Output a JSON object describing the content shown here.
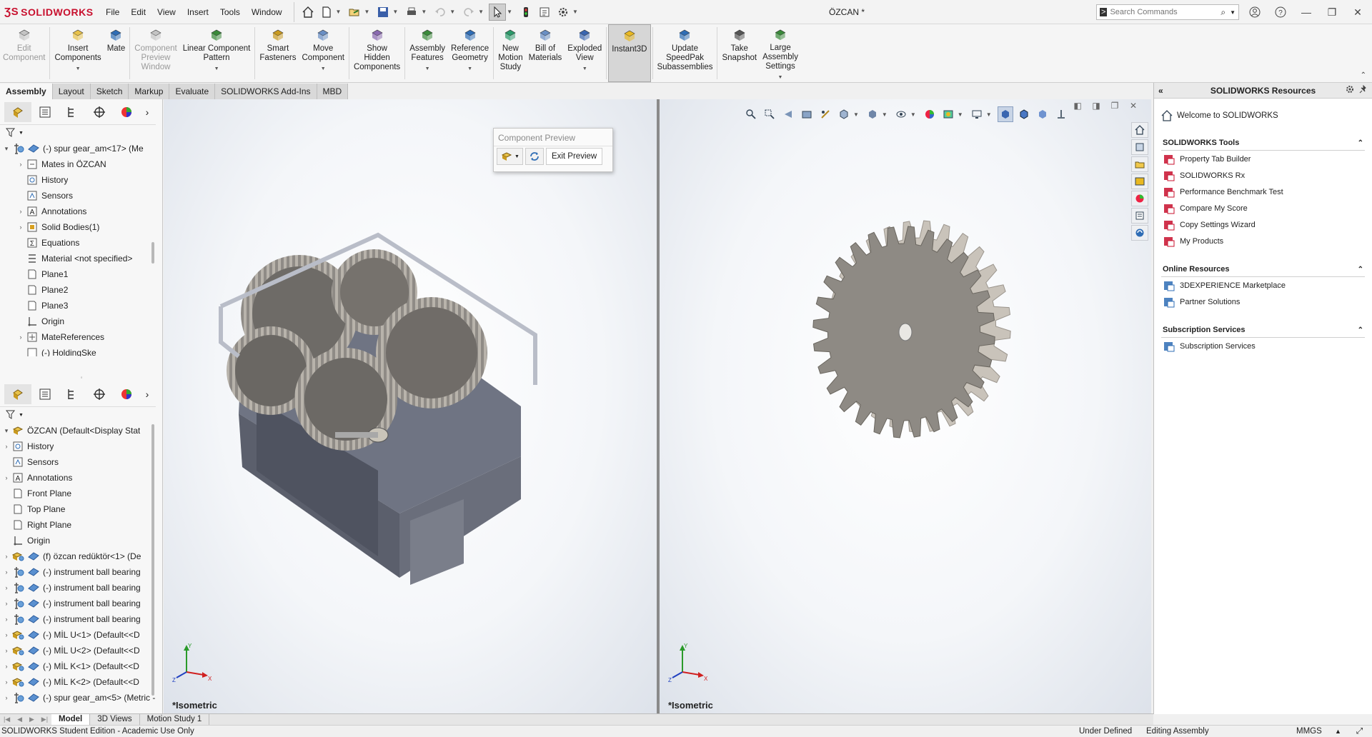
{
  "app": {
    "logo_text": "SOLIDWORKS",
    "doc_title": "ÖZCAN *",
    "menu": [
      "File",
      "Edit",
      "View",
      "Insert",
      "Tools",
      "Window"
    ],
    "search_placeholder": "Search Commands"
  },
  "ribbon": [
    {
      "label": "Edit\nComponent",
      "icon": "edit-component-icon",
      "state": "disabled"
    },
    {
      "label": "Insert\nComponents",
      "icon": "insert-components-icon",
      "dropdown": true
    },
    {
      "label": "Mate",
      "icon": "mate-icon"
    },
    {
      "label": "Component\nPreview\nWindow",
      "icon": "component-preview-icon",
      "state": "disabled"
    },
    {
      "label": "Linear Component\nPattern",
      "icon": "linear-pattern-icon",
      "dropdown": true
    },
    {
      "label": "Smart\nFasteners",
      "icon": "smart-fasteners-icon"
    },
    {
      "label": "Move\nComponent",
      "icon": "move-component-icon",
      "dropdown": true
    },
    {
      "label": "Show\nHidden\nComponents",
      "icon": "show-hidden-icon"
    },
    {
      "label": "Assembly\nFeatures",
      "icon": "assembly-features-icon",
      "dropdown": true
    },
    {
      "label": "Reference\nGeometry",
      "icon": "reference-geometry-icon",
      "dropdown": true
    },
    {
      "label": "New\nMotion\nStudy",
      "icon": "motion-study-icon"
    },
    {
      "label": "Bill of\nMaterials",
      "icon": "bom-icon"
    },
    {
      "label": "Exploded\nView",
      "icon": "exploded-view-icon",
      "dropdown": true
    },
    {
      "label": "Instant3D",
      "icon": "instant3d-icon",
      "state": "active"
    },
    {
      "label": "Update\nSpeedPak\nSubassemblies",
      "icon": "speedpak-icon"
    },
    {
      "label": "Take\nSnapshot",
      "icon": "snapshot-icon"
    },
    {
      "label": "Large\nAssembly\nSettings",
      "icon": "large-assembly-icon",
      "dropdown": true
    }
  ],
  "tabs": [
    "Assembly",
    "Layout",
    "Sketch",
    "Markup",
    "Evaluate",
    "SOLIDWORKS Add-Ins",
    "MBD"
  ],
  "tree_top": [
    {
      "label": "(-) spur gear_am<17> (Me",
      "icon": "part-icon",
      "expand": "-"
    },
    {
      "label": "Mates in ÖZCAN",
      "icon": "mates-icon",
      "expand": "+",
      "indent": 1
    },
    {
      "label": "History",
      "icon": "history-icon",
      "indent": 1
    },
    {
      "label": "Sensors",
      "icon": "sensors-icon",
      "indent": 1
    },
    {
      "label": "Annotations",
      "icon": "annotations-icon",
      "expand": "+",
      "indent": 1
    },
    {
      "label": "Solid Bodies(1)",
      "icon": "solid-bodies-icon",
      "expand": "+",
      "indent": 1
    },
    {
      "label": "Equations",
      "icon": "equations-icon",
      "indent": 1
    },
    {
      "label": "Material <not specified>",
      "icon": "material-icon",
      "indent": 1
    },
    {
      "label": "Plane1",
      "icon": "plane-icon",
      "indent": 1
    },
    {
      "label": "Plane2",
      "icon": "plane-icon",
      "indent": 1
    },
    {
      "label": "Plane3",
      "icon": "plane-icon",
      "indent": 1
    },
    {
      "label": "Origin",
      "icon": "origin-icon",
      "indent": 1
    },
    {
      "label": "MateReferences",
      "icon": "mate-references-icon",
      "expand": "+",
      "indent": 1
    },
    {
      "label": "(-) HoldingSke",
      "icon": "sketch-icon",
      "indent": 1
    }
  ],
  "tree_bottom": [
    {
      "label": "ÖZCAN  (Default<Display Stat",
      "icon": "assembly-icon",
      "expand": "-"
    },
    {
      "label": "History",
      "icon": "history-icon",
      "expand": "+"
    },
    {
      "label": "Sensors",
      "icon": "sensors-icon"
    },
    {
      "label": "Annotations",
      "icon": "annotations-icon",
      "expand": "+"
    },
    {
      "label": "Front Plane",
      "icon": "plane-icon"
    },
    {
      "label": "Top Plane",
      "icon": "plane-icon"
    },
    {
      "label": "Right Plane",
      "icon": "plane-icon"
    },
    {
      "label": "Origin",
      "icon": "origin-icon"
    },
    {
      "label": "(f) özcan redüktör<1> (De",
      "icon": "assembly-part-icon",
      "expand": "+"
    },
    {
      "label": "(-) instrument ball bearing",
      "icon": "part-icon",
      "expand": "+"
    },
    {
      "label": "(-) instrument ball bearing",
      "icon": "part-icon",
      "expand": "+"
    },
    {
      "label": "(-) instrument ball bearing",
      "icon": "part-icon",
      "expand": "+"
    },
    {
      "label": "(-) instrument ball bearing",
      "icon": "part-icon",
      "expand": "+"
    },
    {
      "label": "(-) MİL U<1> (Default<<D",
      "icon": "assembly-part-icon",
      "expand": "+"
    },
    {
      "label": "(-) MİL U<2> (Default<<D",
      "icon": "assembly-part-icon",
      "expand": "+"
    },
    {
      "label": "(-) MİL K<1> (Default<<D",
      "icon": "assembly-part-icon",
      "expand": "+"
    },
    {
      "label": "(-) MİL K<2> (Default<<D",
      "icon": "assembly-part-icon",
      "expand": "+"
    },
    {
      "label": "(-) spur gear_am<5> (Metric -",
      "icon": "part-icon",
      "expand": "+"
    }
  ],
  "viewport1": {
    "label": "*Isometric"
  },
  "viewport2": {
    "label": "*Isometric"
  },
  "popup": {
    "title": "Component Preview",
    "exit_label": "Exit Preview"
  },
  "taskpane": {
    "title": "SOLIDWORKS Resources",
    "welcome": "Welcome to SOLIDWORKS",
    "sections": [
      {
        "title": "SOLIDWORKS Tools",
        "items": [
          "Property Tab Builder",
          "SOLIDWORKS Rx",
          "Performance Benchmark Test",
          "Compare My Score",
          "Copy Settings Wizard",
          "My Products"
        ]
      },
      {
        "title": "Online Resources",
        "items": [
          "3DEXPERIENCE Marketplace",
          "Partner Solutions"
        ]
      },
      {
        "title": "Subscription Services",
        "items": [
          "Subscription Services"
        ]
      }
    ]
  },
  "bottom_tabs": [
    "Model",
    "3D Views",
    "Motion Study 1"
  ],
  "status": {
    "edition": "SOLIDWORKS Student Edition - Academic Use Only",
    "defined": "Under Defined",
    "mode": "Editing Assembly",
    "units": "MMGS"
  },
  "colors": {
    "brand": "#c8102e",
    "gear": "#8e8a84",
    "housing": "#5f6472"
  }
}
